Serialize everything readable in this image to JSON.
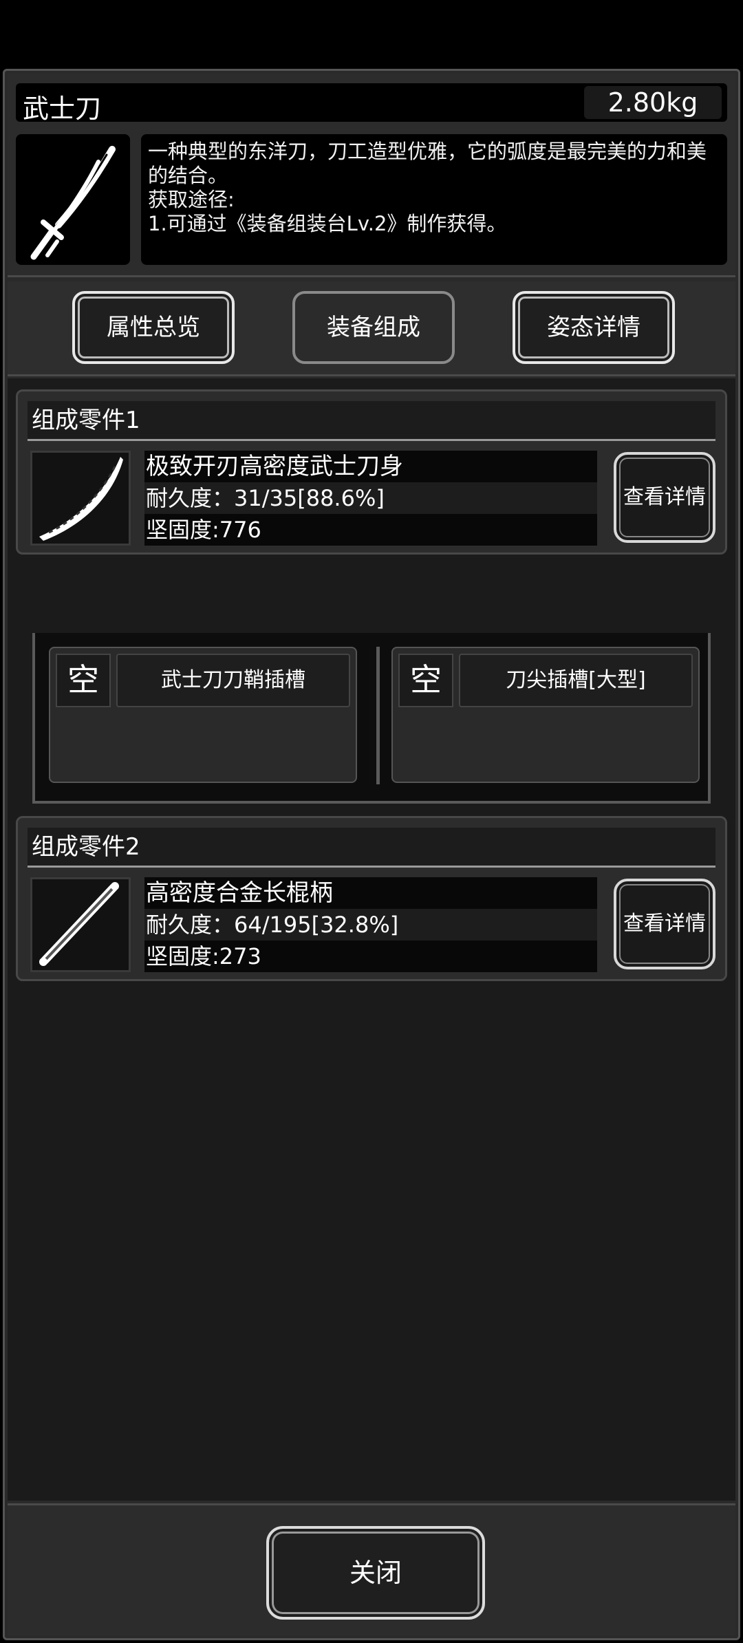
{
  "item": {
    "name": "武士刀",
    "weight": "2.80kg",
    "description_lines": [
      "一种典型的东洋刀，刀工造型优雅，它的弧度是最完美的力和美的结合。",
      "获取途径:",
      "1.可通过《装备组装台Lv.2》制作获得。"
    ],
    "icon": "katana-icon"
  },
  "tabs": [
    {
      "label": "属性总览"
    },
    {
      "label": "装备组成"
    },
    {
      "label": "姿态详情"
    }
  ],
  "parts": [
    {
      "heading": "组成零件1",
      "name": "极致开刃高密度武士刀身",
      "durability": "耐久度：31/35[88.6%]",
      "hardness": "坚固度:776",
      "detail_label": "查看详情",
      "icon": "blade-icon"
    },
    {
      "heading": "组成零件2",
      "name": "高密度合金长棍柄",
      "durability": "耐久度：64/195[32.8%]",
      "hardness": "坚固度:273",
      "detail_label": "查看详情",
      "icon": "staff-handle-icon"
    }
  ],
  "slots": [
    {
      "status": "空",
      "label": "武士刀刀鞘插槽"
    },
    {
      "status": "空",
      "label": "刀尖插槽[大型]"
    }
  ],
  "footer": {
    "close_label": "关闭"
  }
}
